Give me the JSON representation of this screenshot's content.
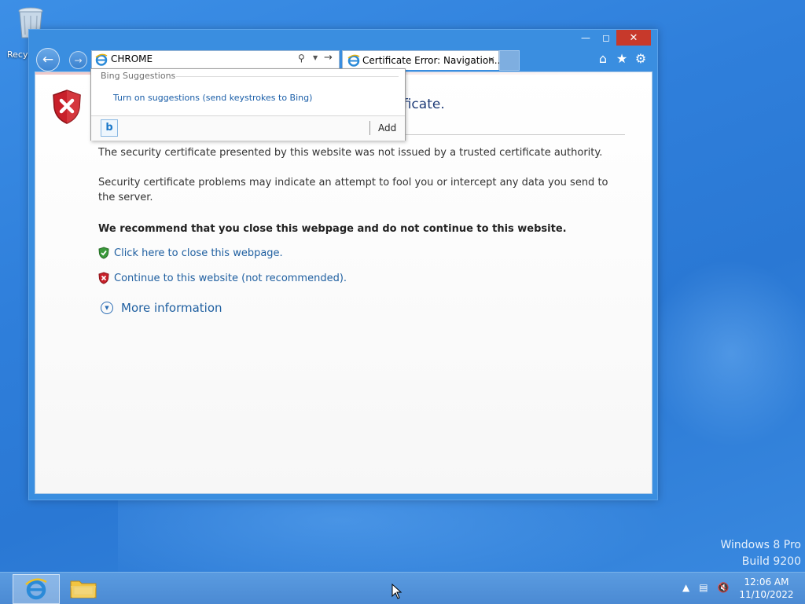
{
  "desktop": {
    "recycle_label": "Recyc",
    "watermark": [
      "Windows 8 Pro",
      "Build 9200"
    ]
  },
  "browser": {
    "address_value": "CHROME",
    "tab_label": "Certificate Error: Navigation...",
    "tab_close": "×"
  },
  "suggestions": {
    "heading": "Bing Suggestions",
    "item": "Turn on suggestions (send keystrokes to Bing)",
    "add_label": "Add"
  },
  "page": {
    "title_partial": "ificate.",
    "p1": "The security certificate presented by this website was not issued by a trusted certificate authority.",
    "p2": "Security certificate problems may indicate an attempt to fool you or intercept any data you send to the server.",
    "p3": "We recommend that you close this webpage and do not continue to this website.",
    "link_close": "Click here to close this webpage.",
    "link_continue": "Continue to this website (not recommended).",
    "more_info": "More information"
  },
  "taskbar": {
    "time": "12:06 AM",
    "date": "11/10/2022"
  },
  "colors": {
    "accent": "#2f7fdb",
    "close_red": "#c7392b",
    "link": "#1f5fa0"
  },
  "icons": [
    "recycle-bin-icon",
    "back-icon",
    "forward-icon",
    "ie-icon",
    "search-icon",
    "go-icon",
    "home-icon",
    "favorites-icon",
    "gear-icon",
    "shield-error-icon",
    "shield-ok-icon",
    "expand-icon",
    "bing-icon",
    "folder-icon",
    "network-icon",
    "volume-muted-icon"
  ]
}
